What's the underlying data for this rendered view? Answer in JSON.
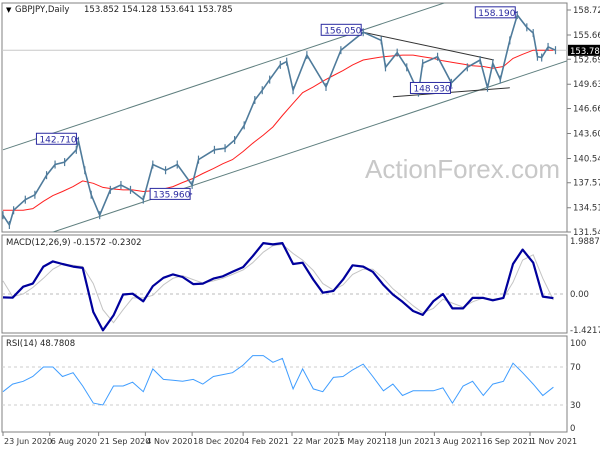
{
  "header": {
    "symbol": "GBPJPY,Daily",
    "ohlc": "153.852 154.128 153.641 153.785"
  },
  "watermark": "ActionForex.com",
  "colors": {
    "price": "#4f7b9b",
    "ma": "#ff2020",
    "macd": "#00009c",
    "signal": "#c4c4c4",
    "rsi": "#3f9dff",
    "label_border": "#2a2aa0",
    "channel": "#5f7f7f",
    "trend": "#333333"
  },
  "chart_data": [
    {
      "type": "line",
      "panel": "price",
      "ylim": [
        131.54,
        158.72
      ],
      "yticks": [
        "158.720",
        "155.660",
        "152.690",
        "149.630",
        "146.660",
        "143.600",
        "140.540",
        "137.570",
        "134.510",
        "131.540"
      ],
      "current_price": "153.785",
      "xticks": [
        "23 Jun 2020",
        "6 Aug 2020",
        "21 Sep 2020",
        "4 Nov 2020",
        "18 Dec 2020",
        "4 Feb 2021",
        "22 Mar 2021",
        "5 May 2021",
        "18 Jun 2021",
        "3 Aug 2021",
        "16 Sep 2021",
        "1 Nov 2021"
      ],
      "price": [
        [
          "2020-06-23",
          133.6
        ],
        [
          "2020-06-29",
          132.4
        ],
        [
          "2020-07-03",
          134.2
        ],
        [
          "2020-07-14",
          135.5
        ],
        [
          "2020-07-23",
          136.1
        ],
        [
          "2020-08-03",
          138.5
        ],
        [
          "2020-08-11",
          139.8
        ],
        [
          "2020-08-20",
          140.1
        ],
        [
          "2020-08-31",
          141.6
        ],
        [
          "2020-09-02",
          142.7
        ],
        [
          "2020-09-08",
          139.1
        ],
        [
          "2020-09-14",
          136.1
        ],
        [
          "2020-09-22",
          133.6
        ],
        [
          "2020-10-02",
          136.7
        ],
        [
          "2020-10-12",
          137.3
        ],
        [
          "2020-10-21",
          136.7
        ],
        [
          "2020-11-02",
          135.5
        ],
        [
          "2020-11-11",
          139.8
        ],
        [
          "2020-11-23",
          139.1
        ],
        [
          "2020-12-04",
          139.8
        ],
        [
          "2020-12-18",
          137.3
        ],
        [
          "2020-12-24",
          140.4
        ],
        [
          "2021-01-08",
          141.6
        ],
        [
          "2021-01-18",
          141.8
        ],
        [
          "2021-01-27",
          142.8
        ],
        [
          "2021-02-05",
          144.6
        ],
        [
          "2021-02-15",
          147.7
        ],
        [
          "2021-02-22",
          148.9
        ],
        [
          "2021-03-01",
          150.2
        ],
        [
          "2021-03-11",
          152.0
        ],
        [
          "2021-03-17",
          152.4
        ],
        [
          "2021-03-23",
          148.9
        ],
        [
          "2021-04-05",
          153.2
        ],
        [
          "2021-04-23",
          149.3
        ],
        [
          "2021-05-07",
          153.8
        ],
        [
          "2021-05-28",
          156.0
        ],
        [
          "2021-06-14",
          155.0
        ],
        [
          "2021-06-18",
          151.7
        ],
        [
          "2021-06-29",
          153.5
        ],
        [
          "2021-07-08",
          151.7
        ],
        [
          "2021-07-19",
          148.6
        ],
        [
          "2021-07-23",
          152.2
        ],
        [
          "2021-08-06",
          153.0
        ],
        [
          "2021-08-19",
          149.8
        ],
        [
          "2021-09-03",
          151.7
        ],
        [
          "2021-09-15",
          152.6
        ],
        [
          "2021-09-22",
          149.2
        ],
        [
          "2021-09-27",
          152.2
        ],
        [
          "2021-10-04",
          150.2
        ],
        [
          "2021-10-13",
          155.0
        ],
        [
          "2021-10-20",
          158.1
        ],
        [
          "2021-10-29",
          156.6
        ],
        [
          "2021-11-04",
          155.9
        ],
        [
          "2021-11-08",
          153.0
        ],
        [
          "2021-11-12",
          152.9
        ],
        [
          "2021-11-18",
          154.2
        ],
        [
          "2021-11-25",
          153.8
        ]
      ],
      "grid_dates": [
        "2020-06-23",
        "2020-07-02",
        "2020-07-12",
        "2020-07-21",
        "2020-07-31",
        "2020-08-09",
        "2020-08-18",
        "2020-08-28",
        "2020-09-06",
        "2020-09-16",
        "2020-09-25",
        "2020-10-05",
        "2020-10-14",
        "2020-10-23",
        "2020-11-02",
        "2020-11-11",
        "2020-11-21",
        "2020-11-30",
        "2020-12-09",
        "2020-12-19",
        "2020-12-28",
        "2021-01-07",
        "2021-01-16",
        "2021-01-25",
        "2021-02-04",
        "2021-02-13",
        "2021-02-23",
        "2021-03-04",
        "2021-03-13",
        "2021-03-23",
        "2021-04-01",
        "2021-04-11",
        "2021-04-20",
        "2021-04-30",
        "2021-05-09",
        "2021-05-18",
        "2021-05-28",
        "2021-06-06",
        "2021-06-16",
        "2021-06-25",
        "2021-07-04",
        "2021-07-14",
        "2021-07-23",
        "2021-08-02",
        "2021-08-11",
        "2021-08-20",
        "2021-08-30",
        "2021-09-08",
        "2021-09-18",
        "2021-09-27",
        "2021-10-07",
        "2021-10-16",
        "2021-10-25",
        "2021-11-04",
        "2021-11-13",
        "2021-11-23"
      ],
      "moving_average": [
        134.2,
        134.2,
        134.2,
        134.4,
        135.3,
        136.0,
        136.5,
        137.1,
        137.8,
        137.5,
        137.0,
        136.8,
        136.7,
        136.7,
        136.5,
        136.6,
        136.8,
        137.1,
        137.6,
        138.1,
        138.7,
        139.3,
        139.9,
        140.4,
        141.4,
        142.4,
        143.4,
        144.4,
        145.8,
        147.3,
        148.6,
        149.3,
        150.0,
        150.7,
        151.3,
        152.0,
        152.6,
        152.8,
        153.0,
        153.1,
        153.2,
        153.2,
        153.0,
        152.8,
        152.5,
        152.3,
        152.1,
        151.9,
        151.8,
        151.6,
        151.8,
        152.8,
        153.3,
        153.8,
        153.8,
        153.8
      ],
      "annotations": [
        {
          "text": "142.710",
          "date": "2020-09-02",
          "value": 142.71
        },
        {
          "text": "135.960",
          "date": "2020-12-18",
          "value": 135.96
        },
        {
          "text": "156.050",
          "date": "2021-05-28",
          "value": 156.05
        },
        {
          "text": "148.930",
          "date": "2021-08-20",
          "value": 148.93
        },
        {
          "text": "158.190",
          "date": "2021-10-20",
          "value": 158.19
        }
      ],
      "trendlines": [
        {
          "kind": "channel-upper",
          "points": [
            [
              "2020-06-23",
              141.6
            ],
            [
              "2021-08-15",
              159.7
            ]
          ]
        },
        {
          "kind": "channel-lower",
          "points": [
            [
              "2020-08-06",
              131.4
            ],
            [
              "2021-12-06",
              152.5
            ]
          ]
        },
        {
          "kind": "descending-resistance",
          "points": [
            [
              "2021-05-28",
              156.0
            ],
            [
              "2021-09-28",
              152.6
            ]
          ]
        },
        {
          "kind": "support",
          "points": [
            [
              "2021-06-25",
              148.1
            ],
            [
              "2021-10-13",
              149.2
            ]
          ]
        }
      ]
    },
    {
      "type": "line",
      "panel": "macd",
      "title": "MACD(12,26,9) -0.1572 -0.2302",
      "ylim": [
        -1.4217,
        1.9887
      ],
      "yticks": [
        "1.9887",
        "0.00",
        "-1.4217"
      ],
      "macd": [
        -0.13,
        -0.14,
        0.28,
        0.4,
        1.05,
        1.25,
        1.15,
        1.05,
        1.0,
        -0.69,
        -1.39,
        -0.82,
        -0.02,
        0.01,
        -0.28,
        0.3,
        0.62,
        0.75,
        0.65,
        0.38,
        0.4,
        0.59,
        0.68,
        0.85,
        1.03,
        1.45,
        1.95,
        1.9,
        1.95,
        1.15,
        1.2,
        0.55,
        0.05,
        0.12,
        0.55,
        1.1,
        1.05,
        0.85,
        0.35,
        -0.02,
        -0.3,
        -0.65,
        -0.8,
        -0.28,
        0.0,
        -0.55,
        -0.55,
        -0.15,
        -0.15,
        -0.24,
        -0.15,
        1.15,
        1.7,
        1.2,
        -0.1,
        -0.1572
      ],
      "signal": [
        0.5,
        -0.1,
        0.0,
        0.25,
        0.6,
        0.95,
        1.15,
        1.1,
        1.05,
        0.4,
        -0.6,
        -1.1,
        -0.6,
        -0.15,
        -0.15,
        -0.05,
        0.35,
        0.6,
        0.7,
        0.55,
        0.42,
        0.5,
        0.6,
        0.75,
        0.92,
        1.2,
        1.6,
        1.85,
        1.9,
        1.55,
        1.3,
        0.9,
        0.4,
        0.15,
        0.35,
        0.75,
        0.95,
        0.95,
        0.6,
        0.2,
        -0.1,
        -0.45,
        -0.72,
        -0.55,
        -0.2,
        -0.35,
        -0.5,
        -0.3,
        -0.15,
        -0.2,
        -0.15,
        0.45,
        1.3,
        1.5,
        0.6,
        -0.2302
      ]
    },
    {
      "type": "line",
      "panel": "rsi",
      "title": "RSI(14) 48.7808",
      "ylim": [
        0,
        100
      ],
      "yticks": [
        "100",
        "70",
        "30",
        "0"
      ],
      "levels": [
        70,
        30
      ],
      "rsi": [
        44,
        52,
        55,
        60,
        70,
        70,
        60,
        64,
        50,
        32,
        30,
        50,
        50,
        54,
        44,
        68,
        57,
        56,
        55,
        57,
        52,
        60,
        62,
        64,
        72,
        82,
        82,
        75,
        79,
        47,
        68,
        47,
        44,
        59,
        60,
        67,
        73,
        60,
        45,
        52,
        40,
        45,
        45,
        45,
        48,
        32,
        50,
        55,
        40,
        52,
        55,
        74,
        64,
        52,
        40,
        48.78
      ]
    }
  ]
}
